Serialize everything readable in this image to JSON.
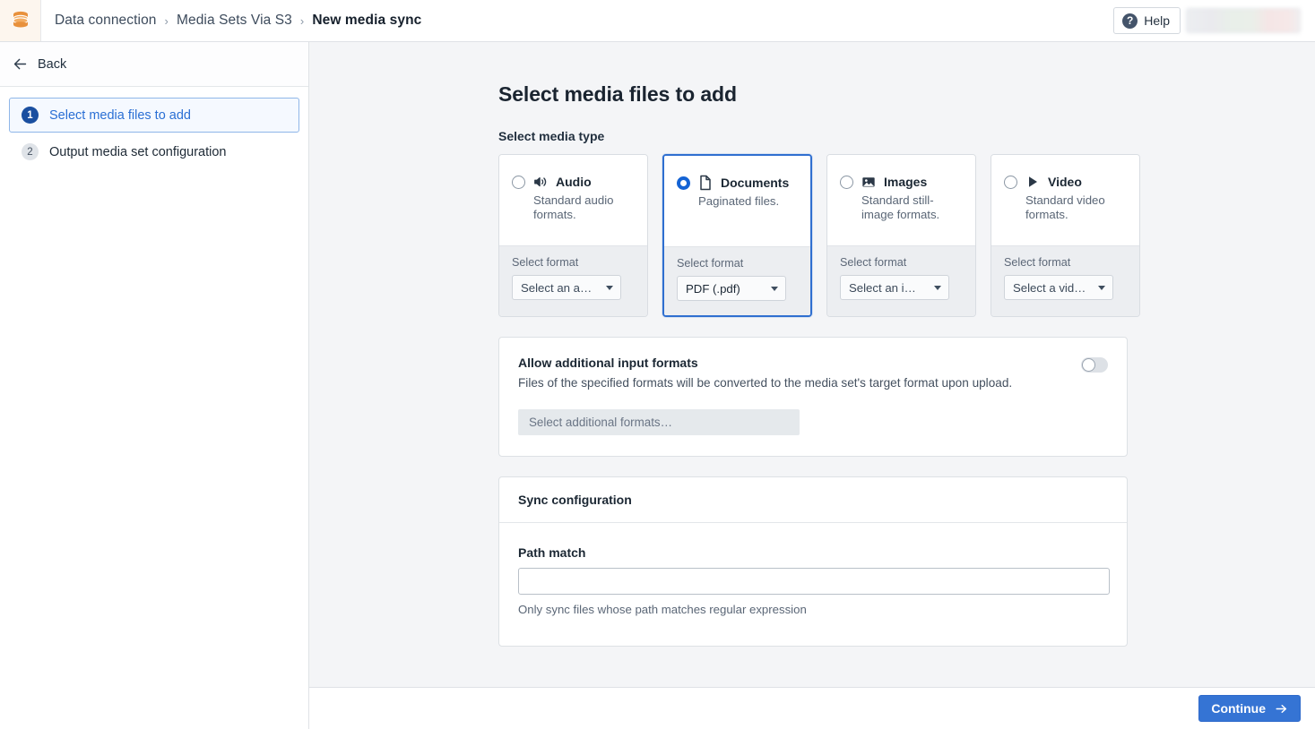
{
  "topbar": {
    "logo_icon": "database-icon",
    "breadcrumb": [
      {
        "label": "Data connection",
        "current": false
      },
      {
        "label": "Media Sets Via S3",
        "current": false
      },
      {
        "label": "New media sync",
        "current": true
      }
    ],
    "separator": "›",
    "help_label": "Help",
    "help_icon": "question-circle-icon",
    "account_widget": ""
  },
  "sidebar": {
    "back_label": "Back",
    "back_icon": "arrow-left-icon",
    "steps": [
      {
        "number": "1",
        "label": "Select media files to add",
        "active": true
      },
      {
        "number": "2",
        "label": "Output media set configuration",
        "active": false
      }
    ]
  },
  "main": {
    "page_title": "Select media files to add",
    "media_type_label": "Select media type",
    "media_types": [
      {
        "name": "Audio",
        "icon": "speaker-icon",
        "description": "Standard audio formats.",
        "selected": false,
        "format_label": "Select format",
        "format_value": "Select an a…"
      },
      {
        "name": "Documents",
        "icon": "document-icon",
        "description": "Paginated files.",
        "selected": true,
        "format_label": "Select format",
        "format_value": "PDF (.pdf)"
      },
      {
        "name": "Images",
        "icon": "image-icon",
        "description": "Standard still-image formats.",
        "selected": false,
        "format_label": "Select format",
        "format_value": "Select an i…"
      },
      {
        "name": "Video",
        "icon": "play-icon",
        "description": "Standard video formats.",
        "selected": false,
        "format_label": "Select format",
        "format_value": "Select a vid…"
      }
    ],
    "additional_formats": {
      "title": "Allow additional input formats",
      "description": "Files of the specified formats will be converted to the media set's target format upon upload.",
      "toggle_state": "off",
      "multiselect_placeholder": "Select additional formats…"
    },
    "sync_configuration": {
      "title": "Sync configuration",
      "path_match_label": "Path match",
      "path_match_value": "",
      "path_match_placeholder": "",
      "path_match_help": "Only sync files whose path matches regular expression"
    }
  },
  "footer": {
    "continue_label": "Continue",
    "continue_icon": "arrow-right-icon"
  },
  "colors": {
    "accent_blue": "#3574d4",
    "step_badge_blue": "#1a4fa0",
    "logo_orange": "#e8913c",
    "main_bg": "#f4f5f7"
  }
}
